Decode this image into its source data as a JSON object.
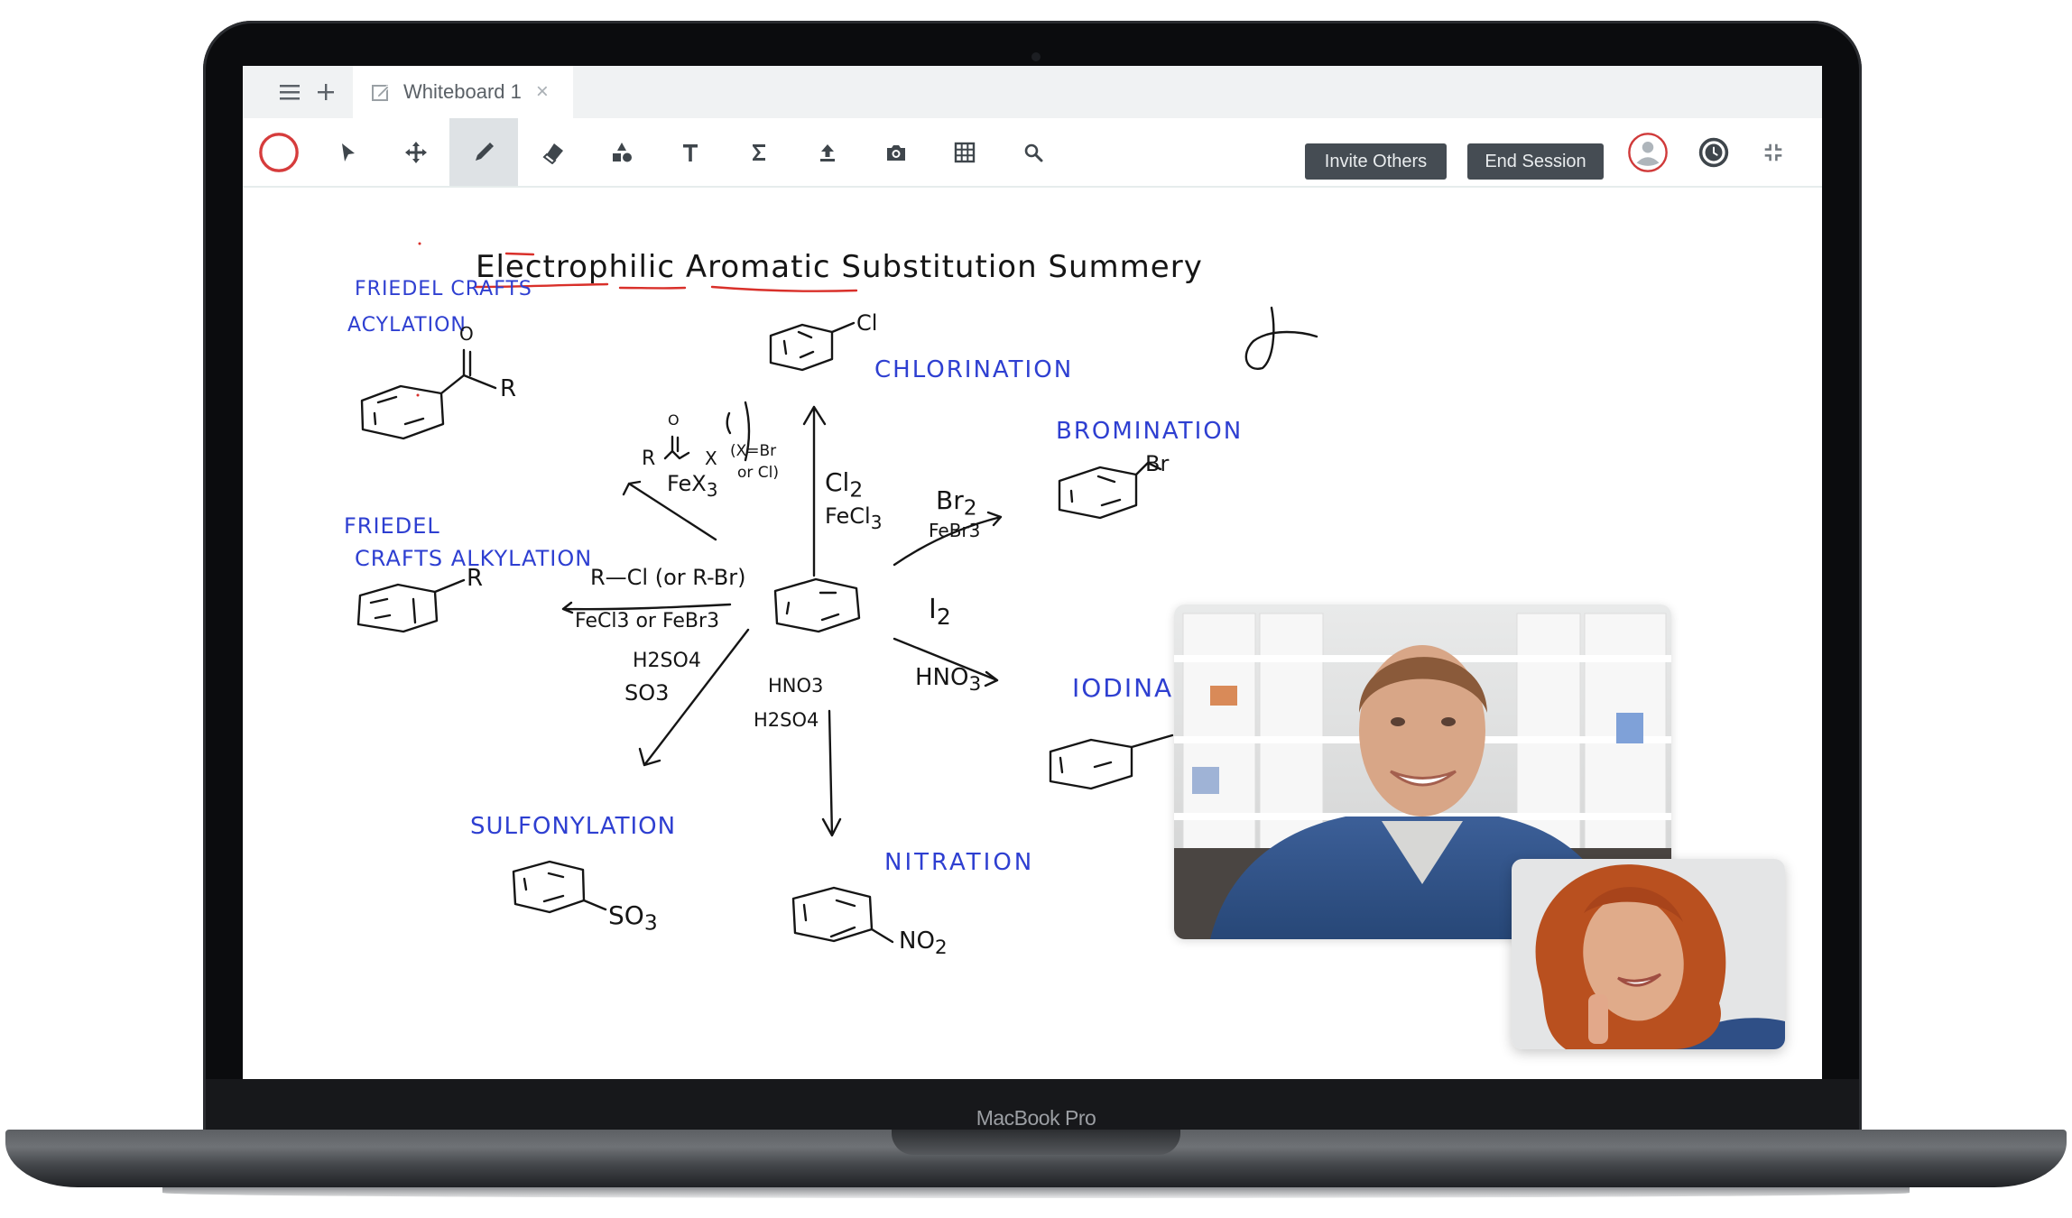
{
  "device": {
    "label": "MacBook Pro"
  },
  "tabbar": {
    "menu_icon": "hamburger-menu-icon",
    "new_tab_icon": "plus-icon",
    "tabs": [
      {
        "label": "Whiteboard 1",
        "icon": "edit-icon",
        "close_icon": "close-icon",
        "active": true
      }
    ]
  },
  "toolbar": {
    "tools": [
      {
        "name": "color-picker",
        "icon": "red-circle-icon",
        "color": "#d63c3c"
      },
      {
        "name": "select",
        "icon": "pointer-arrow-icon"
      },
      {
        "name": "pan",
        "icon": "move-arrows-icon"
      },
      {
        "name": "pen",
        "icon": "pencil-icon",
        "active": true
      },
      {
        "name": "eraser",
        "icon": "eraser-icon"
      },
      {
        "name": "shapes",
        "icon": "shapes-icon"
      },
      {
        "name": "text",
        "icon": "text-T-icon"
      },
      {
        "name": "equation",
        "icon": "sigma-icon"
      },
      {
        "name": "upload",
        "icon": "upload-icon"
      },
      {
        "name": "snapshot",
        "icon": "camera-icon"
      },
      {
        "name": "grid",
        "icon": "grid-icon"
      },
      {
        "name": "zoom",
        "icon": "search-icon"
      }
    ],
    "invite_label": "Invite Others",
    "end_label": "End Session",
    "avatar_icon": "user-avatar-icon",
    "timer_icon": "clock-icon",
    "collapse_icon": "compress-icon"
  },
  "whiteboard": {
    "title": "Electrophilic Aromatic Substitution Summery",
    "labels": {
      "fc_acylation_1": "FRIEDEL CRAFTS",
      "fc_acylation_2": "ACYLATION",
      "chlorination": "CHLORINATION",
      "bromination": "BROMINATION",
      "fc_alkylation_1": "FRIEDEL",
      "fc_alkylation_2": "CRAFTS ALKYLATION",
      "iodination": "IODINA",
      "sulfonylation": "SULFONYLATION",
      "nitration": "NITRATION"
    },
    "substituents": {
      "acyl_o": "O",
      "acyl_r": "R",
      "cl": "Cl",
      "br": "Br",
      "alkyl_r": "R",
      "so3": "SO",
      "so3_sub": "3",
      "no2": "NO",
      "no2_sub": "2"
    },
    "reagents": {
      "acyl_o": "O",
      "acyl_rx": "R—⅃—X",
      "acyl_note1": "(X=Br",
      "acyl_note2": "or Cl)",
      "acyl_cat": "FeX",
      "acyl_cat_sub": "3",
      "cl2": "Cl",
      "cl2_sub": "2",
      "fecl3": "FeCl",
      "fecl3_sub": "3",
      "br2": "Br",
      "br2_sub": "2",
      "febr3": "FeBr3",
      "alkyl_rcl": "R—Cl (or R-Br)",
      "alkyl_cat": "FeCl3 or FeBr3",
      "i2": "I",
      "i2_sub": "2",
      "hno3_right": "HNO",
      "hno3_right_sub": "3",
      "h2so4": "H2SO4",
      "so3": "SO3",
      "hno3_down": "HNO3",
      "h2so4_down": "H2SO4"
    },
    "ink_colors": {
      "black": "#151515",
      "blue": "#2e3fd1",
      "red": "#d9302a"
    }
  },
  "video": {
    "participants": [
      {
        "name": "participant-main",
        "description": "smiling man in blue shirt"
      },
      {
        "name": "participant-self",
        "description": "woman with red curly hair"
      }
    ]
  }
}
